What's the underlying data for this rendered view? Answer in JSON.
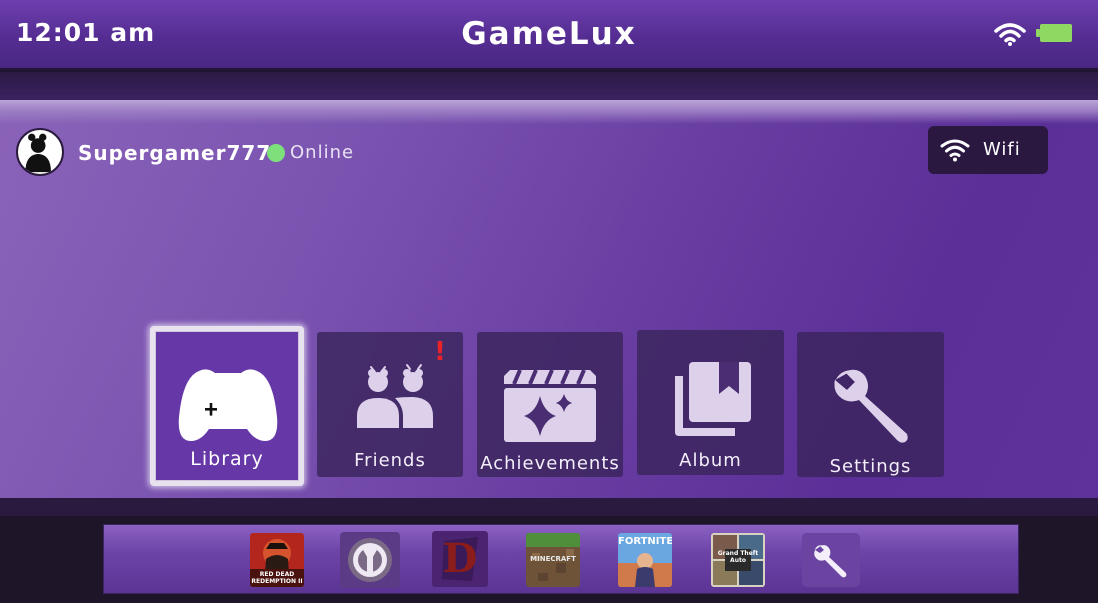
{
  "status_bar": {
    "time": "12:01 am",
    "brand": "GameLux",
    "wifi_icon": "wifi-icon",
    "battery_icon": "battery-icon",
    "battery_color": "#8fd861"
  },
  "profile": {
    "avatar_icon": "user-avatar-icon",
    "username": "Supergamer777",
    "status": "Online",
    "status_color": "#7ee07a"
  },
  "wifi_button": {
    "label": "Wifi",
    "icon": "wifi-icon"
  },
  "tiles": [
    {
      "id": "library",
      "label": "Library",
      "icon": "gamepad-icon",
      "selected": true
    },
    {
      "id": "friends",
      "label": "Friends",
      "icon": "friends-icon",
      "alert": "!"
    },
    {
      "id": "achievements",
      "label": "Achievements",
      "icon": "clapperboard-sparkle-icon"
    },
    {
      "id": "album",
      "label": "Album",
      "icon": "photo-library-icon"
    },
    {
      "id": "settings",
      "label": "Settings",
      "icon": "wrench-icon"
    }
  ],
  "dock": {
    "items": [
      {
        "name": "Red Dead Redemption II",
        "icon": "game-tile-red-dead-redemption",
        "art_text": "RED DEAD REDEMPTION II"
      },
      {
        "name": "Overwatch",
        "icon": "game-tile-overwatch"
      },
      {
        "name": "Diablo",
        "icon": "game-tile-diablo",
        "art_text": "D"
      },
      {
        "name": "Minecraft",
        "icon": "game-tile-minecraft",
        "art_text": "MINECRAFT"
      },
      {
        "name": "Fortnite",
        "icon": "game-tile-fortnite",
        "art_text": "FORTNITE"
      },
      {
        "name": "Grand Theft Auto V",
        "icon": "game-tile-gta-v",
        "art_text": "Grand Theft Auto"
      },
      {
        "name": "Settings",
        "icon": "wrench-icon"
      }
    ]
  },
  "colors": {
    "accent_purple": "#6637a6",
    "alert_red": "#e8232a"
  }
}
